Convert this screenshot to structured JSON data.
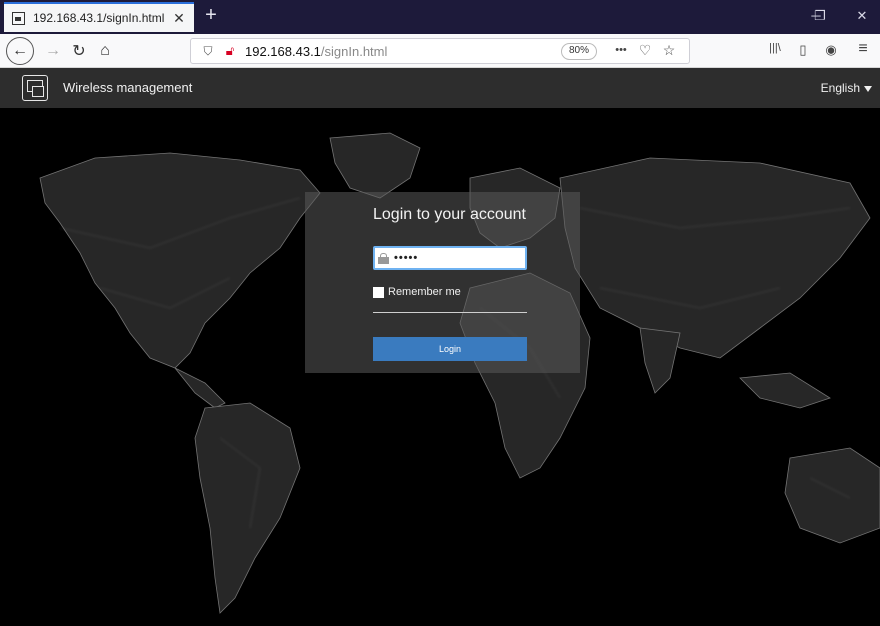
{
  "browser": {
    "tab_title": "192.168.43.1/signIn.html",
    "tab_close": "✕",
    "new_tab": "+",
    "window": {
      "minimize": "─",
      "maximize": "❐",
      "close": "✕"
    },
    "url_host": "192.168.43.1",
    "url_path": "/signIn.html",
    "zoom": "80%",
    "nav": {
      "back": "←",
      "forward": "→",
      "reload": "↻",
      "home": "⌂"
    },
    "url_icons": {
      "more": "•••",
      "pocket": "♡",
      "bookmark": "☆"
    },
    "toolbar_icons": {
      "library": "|||\\",
      "sidebar": "▯",
      "account": "◉",
      "menu": "≡"
    }
  },
  "app": {
    "title": "Wireless management",
    "language": "English"
  },
  "login": {
    "heading": "Login to your account",
    "password_mask": "•••••",
    "remember_label": "Remember me",
    "button_label": "Login"
  },
  "colors": {
    "accent": "#3a7bbf",
    "focus_border": "#6fb2f1",
    "tab_indicator": "#2b6fdb",
    "insecure_lock": "#d70022"
  }
}
